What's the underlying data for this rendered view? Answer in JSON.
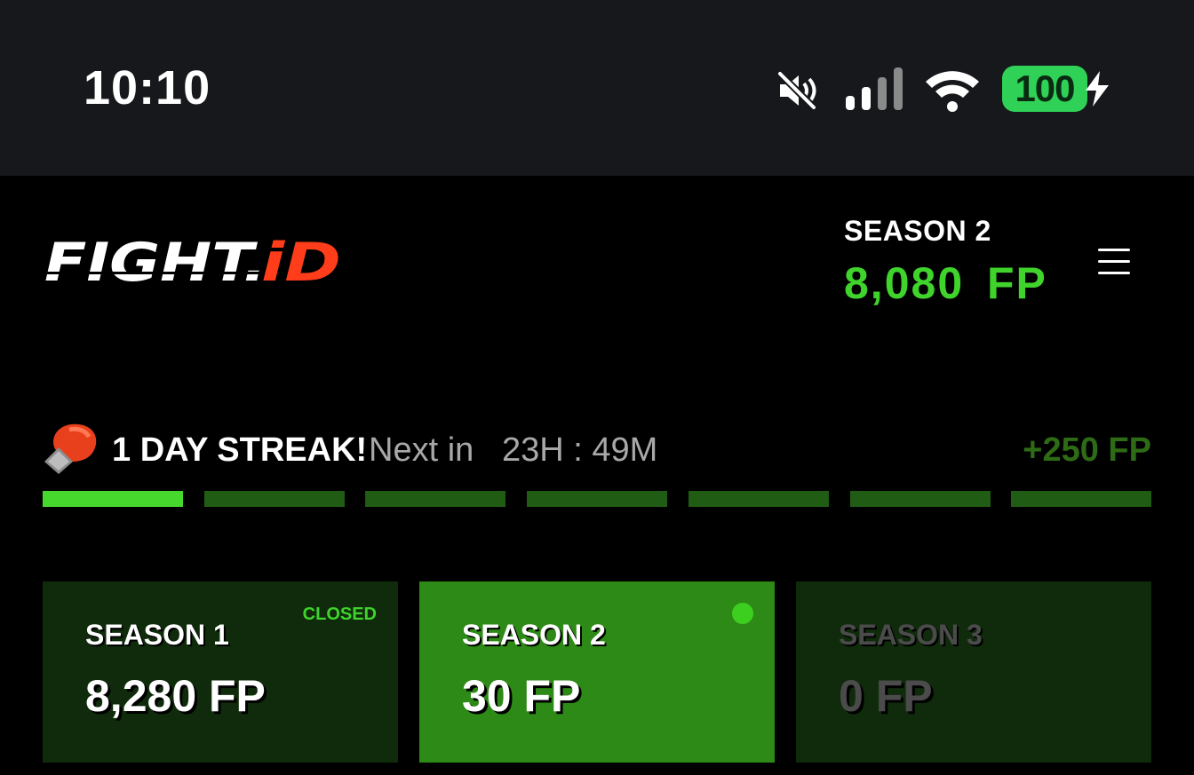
{
  "status_bar": {
    "time": "10:10",
    "battery": "100",
    "battery_color": "#2fd256"
  },
  "header": {
    "logo": "FIGHT.iD",
    "season_label": "SEASON 2",
    "season_points": "8,080 FP",
    "accent_color": "#3fd32c",
    "icons": [
      "mute-icon",
      "signal-icon",
      "wifi-icon",
      "bolt-icon",
      "menu-icon"
    ]
  },
  "streak": {
    "title": "1 DAY STREAK!",
    "next_label": "Next in",
    "timer": "23H : 49M",
    "bonus": "+250 FP",
    "days_completed": 1,
    "days_total": 7
  },
  "seasons": [
    {
      "title": "SEASON 1",
      "points": "8,280 FP",
      "status": "CLOSED"
    },
    {
      "title": "SEASON 2",
      "points": "30 FP",
      "status": ""
    },
    {
      "title": "SEASON 3",
      "points": "0 FP",
      "status": ""
    }
  ]
}
